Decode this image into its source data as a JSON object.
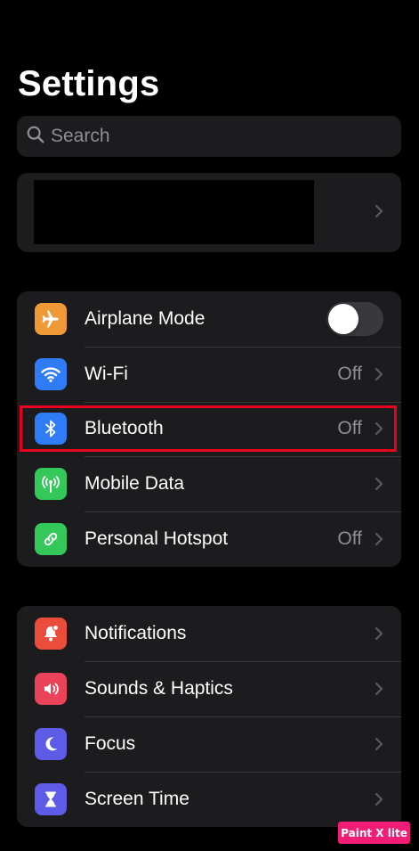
{
  "header": {
    "title": "Settings"
  },
  "search": {
    "placeholder": "Search",
    "icon": "search-icon"
  },
  "profile": {
    "icon": "chevron-right-icon"
  },
  "group1": {
    "rows": [
      {
        "label": "Airplane Mode",
        "icon": "airplane-icon",
        "color": "#f09a37",
        "toggle_on": false
      },
      {
        "label": "Wi-Fi",
        "value": "Off",
        "icon": "wifi-icon",
        "color": "#2f7cf6"
      },
      {
        "label": "Bluetooth",
        "value": "Off",
        "icon": "bluetooth-icon",
        "color": "#2f7cf6",
        "highlighted": true
      },
      {
        "label": "Mobile Data",
        "icon": "antenna-icon",
        "color": "#34c759"
      },
      {
        "label": "Personal Hotspot",
        "value": "Off",
        "icon": "hotspot-icon",
        "color": "#34c759"
      }
    ]
  },
  "group2": {
    "rows": [
      {
        "label": "Notifications",
        "icon": "bell-icon",
        "color": "#eb4d3d"
      },
      {
        "label": "Sounds & Haptics",
        "icon": "speaker-icon",
        "color": "#eb445a"
      },
      {
        "label": "Focus",
        "icon": "moon-icon",
        "color": "#5e5ce6"
      },
      {
        "label": "Screen Time",
        "icon": "hourglass-icon",
        "color": "#5e5ce6"
      }
    ]
  },
  "watermark": {
    "text": "Paint X lite",
    "color": "#f21d77"
  },
  "highlight": {
    "color": "#e8001c"
  }
}
